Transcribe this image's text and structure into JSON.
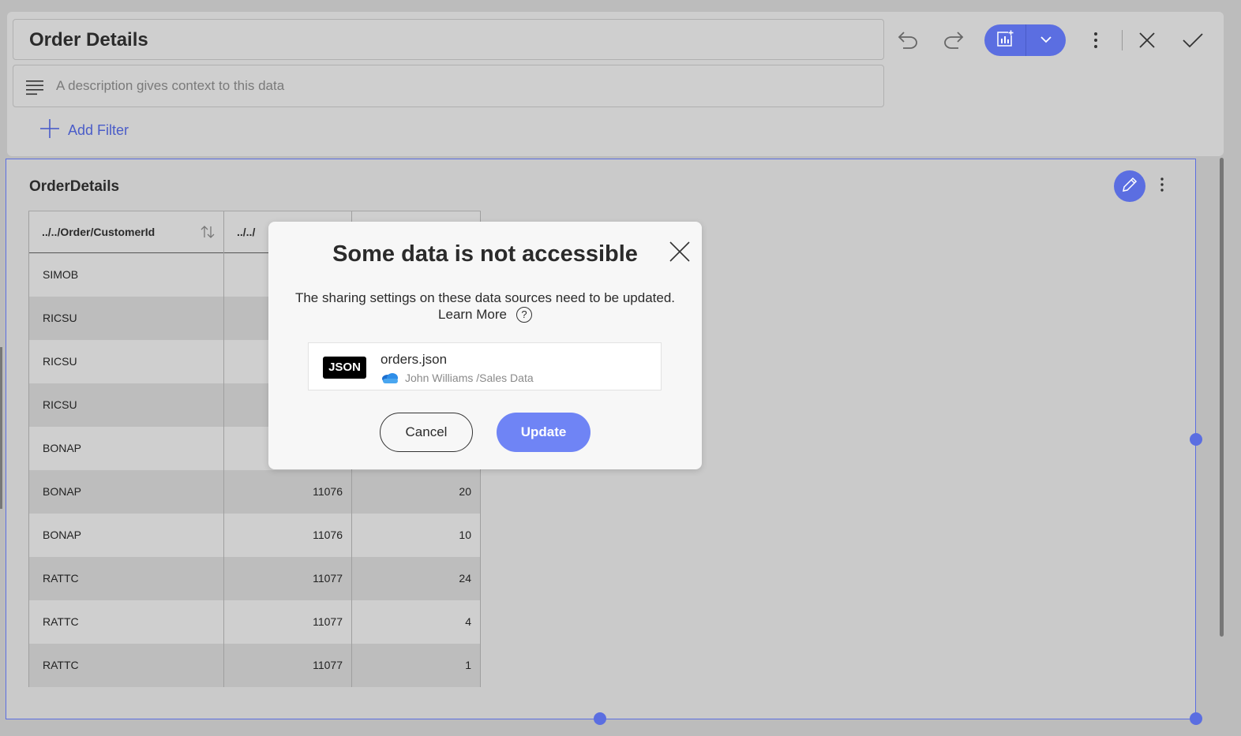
{
  "header": {
    "title": "Order Details",
    "description_placeholder": "A description gives context to this data",
    "add_filter_label": "Add Filter"
  },
  "widget": {
    "title": "OrderDetails",
    "columns": [
      {
        "label": "../../Order/CustomerId"
      },
      {
        "label": "../../"
      }
    ],
    "rows": [
      {
        "customer": "SIMOB",
        "order": "",
        "qty": ""
      },
      {
        "customer": "RICSU",
        "order": "",
        "qty": ""
      },
      {
        "customer": "RICSU",
        "order": "",
        "qty": ""
      },
      {
        "customer": "RICSU",
        "order": "",
        "qty": ""
      },
      {
        "customer": "BONAP",
        "order": "",
        "qty": ""
      },
      {
        "customer": "BONAP",
        "order": "11076",
        "qty": "20"
      },
      {
        "customer": "BONAP",
        "order": "11076",
        "qty": "10"
      },
      {
        "customer": "RATTC",
        "order": "11077",
        "qty": "24"
      },
      {
        "customer": "RATTC",
        "order": "11077",
        "qty": "4"
      },
      {
        "customer": "RATTC",
        "order": "11077",
        "qty": "1"
      }
    ]
  },
  "dialog": {
    "title": "Some data is not accessible",
    "message": "The sharing settings on these data sources need to be updated.",
    "learn_more": "Learn More",
    "help_glyph": "?",
    "source": {
      "badge": "JSON",
      "file_name": "orders.json",
      "path": "John Williams /Sales Data"
    },
    "cancel_label": "Cancel",
    "update_label": "Update"
  },
  "colors": {
    "accent": "#5b6ee1",
    "update_button": "#6f84f5"
  },
  "icons": {
    "undo": "undo-icon",
    "redo": "redo-icon",
    "add_visualization": "chart-add-icon",
    "dropdown": "chevron-down-icon",
    "more": "more-vertical-icon",
    "close": "close-icon",
    "confirm": "check-icon",
    "edit": "pencil-icon",
    "cloud": "onedrive-cloud-icon"
  }
}
